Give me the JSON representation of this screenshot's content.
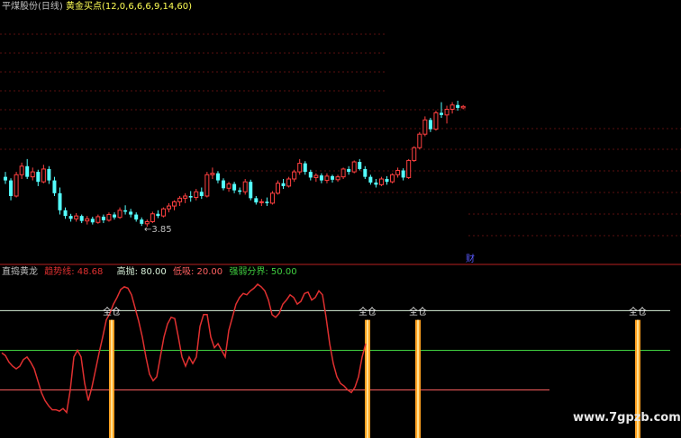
{
  "top_panel": {
    "title": "平煤股份(日线)",
    "indicator": "黄金买点(12,0,6,6,6,9,14,60)",
    "low_annotation": "←3.85",
    "event_marker": "财",
    "colors": {
      "up": "#ff4040",
      "down": "#54ffff",
      "text": "#c0c0c0",
      "indicator_text": "#ffff54"
    }
  },
  "bottom_panel": {
    "title": "直捣黄龙",
    "trend_label": "趋势线",
    "trend_value": "48.68",
    "high_label": "高抛",
    "high_value": "80.00",
    "low_label": "低吸",
    "low_value": "20.00",
    "mid_label": "强弱分界",
    "mid_value": "50.00",
    "signal_label": "全仓",
    "colors": {
      "trend": "#e03030",
      "high": "#d8f0d8",
      "low": "#ff6060",
      "mid": "#40d040",
      "signal": "#ffa020"
    }
  },
  "watermark": "www.7gpzb.com",
  "chart_data": [
    {
      "type": "candlestick",
      "title": "平煤股份(日线)",
      "series": [
        {
          "name": "",
          "values": [
            [
              4.55,
              4.62,
              4.45,
              4.5
            ],
            [
              4.5,
              4.53,
              4.22,
              4.28
            ],
            [
              4.28,
              4.62,
              4.26,
              4.58
            ],
            [
              4.58,
              4.75,
              4.52,
              4.7
            ],
            [
              4.7,
              4.8,
              4.52,
              4.55
            ],
            [
              4.55,
              4.68,
              4.5,
              4.62
            ],
            [
              4.62,
              4.65,
              4.42,
              4.48
            ],
            [
              4.48,
              4.72,
              4.46,
              4.66
            ],
            [
              4.66,
              4.7,
              4.45,
              4.5
            ],
            [
              4.5,
              4.55,
              4.28,
              4.32
            ],
            [
              4.32,
              4.4,
              4.02,
              4.08
            ],
            [
              4.08,
              4.12,
              3.96,
              4.0
            ],
            [
              4.0,
              4.03,
              3.92,
              3.96
            ],
            [
              3.96,
              4.04,
              3.92,
              4.0
            ],
            [
              4.0,
              4.02,
              3.9,
              3.93
            ],
            [
              3.93,
              4.0,
              3.88,
              3.96
            ],
            [
              3.96,
              3.99,
              3.88,
              3.91
            ],
            [
              3.91,
              4.02,
              3.89,
              3.99
            ],
            [
              3.99,
              4.02,
              3.9,
              3.94
            ],
            [
              3.94,
              4.05,
              3.92,
              4.02
            ],
            [
              4.02,
              4.05,
              3.95,
              3.98
            ],
            [
              3.98,
              4.12,
              3.96,
              4.08
            ],
            [
              4.08,
              4.15,
              4.02,
              4.06
            ],
            [
              4.06,
              4.1,
              3.98,
              4.02
            ],
            [
              4.02,
              4.05,
              3.92,
              3.95
            ],
            [
              3.95,
              3.98,
              3.86,
              3.89
            ],
            [
              3.89,
              3.95,
              3.85,
              3.92
            ],
            [
              3.92,
              4.06,
              3.9,
              4.03
            ],
            [
              4.03,
              4.08,
              3.97,
              4.0
            ],
            [
              4.0,
              4.12,
              3.98,
              4.1
            ],
            [
              4.1,
              4.18,
              4.05,
              4.14
            ],
            [
              4.14,
              4.22,
              4.08,
              4.2
            ],
            [
              4.2,
              4.28,
              4.14,
              4.25
            ],
            [
              4.25,
              4.32,
              4.18,
              4.28
            ],
            [
              4.28,
              4.35,
              4.2,
              4.26
            ],
            [
              4.26,
              4.38,
              4.22,
              4.34
            ],
            [
              4.34,
              4.4,
              4.24,
              4.28
            ],
            [
              4.28,
              4.62,
              4.26,
              4.58
            ],
            [
              4.58,
              4.68,
              4.52,
              4.6
            ],
            [
              4.6,
              4.63,
              4.46,
              4.5
            ],
            [
              4.5,
              4.53,
              4.36,
              4.39
            ],
            [
              4.39,
              4.48,
              4.34,
              4.45
            ],
            [
              4.45,
              4.48,
              4.32,
              4.36
            ],
            [
              4.36,
              4.4,
              4.3,
              4.34
            ],
            [
              4.34,
              4.52,
              4.3,
              4.48
            ],
            [
              4.48,
              4.51,
              4.22,
              4.25
            ],
            [
              4.25,
              4.28,
              4.16,
              4.19
            ],
            [
              4.19,
              4.24,
              4.14,
              4.2
            ],
            [
              4.2,
              4.26,
              4.14,
              4.18
            ],
            [
              4.18,
              4.35,
              4.16,
              4.32
            ],
            [
              4.32,
              4.5,
              4.3,
              4.46
            ],
            [
              4.46,
              4.52,
              4.38,
              4.42
            ],
            [
              4.42,
              4.55,
              4.4,
              4.52
            ],
            [
              4.52,
              4.65,
              4.48,
              4.62
            ],
            [
              4.62,
              4.8,
              4.58,
              4.74
            ],
            [
              4.74,
              4.77,
              4.58,
              4.62
            ],
            [
              4.62,
              4.65,
              4.5,
              4.54
            ],
            [
              4.54,
              4.6,
              4.48,
              4.57
            ],
            [
              4.57,
              4.6,
              4.46,
              4.5
            ],
            [
              4.5,
              4.6,
              4.46,
              4.56
            ],
            [
              4.56,
              4.58,
              4.47,
              4.51
            ],
            [
              4.51,
              4.58,
              4.48,
              4.55
            ],
            [
              4.55,
              4.68,
              4.52,
              4.66
            ],
            [
              4.66,
              4.7,
              4.58,
              4.62
            ],
            [
              4.62,
              4.78,
              4.6,
              4.76
            ],
            [
              4.76,
              4.8,
              4.64,
              4.66
            ],
            [
              4.66,
              4.7,
              4.52,
              4.55
            ],
            [
              4.55,
              4.58,
              4.44,
              4.47
            ],
            [
              4.47,
              4.52,
              4.4,
              4.44
            ],
            [
              4.44,
              4.55,
              4.42,
              4.52
            ],
            [
              4.52,
              4.56,
              4.44,
              4.48
            ],
            [
              4.48,
              4.6,
              4.46,
              4.58
            ],
            [
              4.58,
              4.68,
              4.54,
              4.64
            ],
            [
              4.64,
              4.67,
              4.5,
              4.54
            ],
            [
              4.54,
              4.8,
              4.52,
              4.78
            ],
            [
              4.78,
              4.98,
              4.76,
              4.96
            ],
            [
              4.96,
              5.18,
              4.94,
              5.15
            ],
            [
              5.15,
              5.4,
              5.12,
              5.35
            ],
            [
              5.35,
              5.38,
              5.18,
              5.22
            ],
            [
              5.22,
              5.48,
              5.2,
              5.45
            ],
            [
              5.45,
              5.6,
              5.38,
              5.42
            ],
            [
              5.42,
              5.55,
              5.3,
              5.5
            ],
            [
              5.5,
              5.6,
              5.44,
              5.56
            ],
            [
              5.56,
              5.62,
              5.48,
              5.52
            ],
            [
              5.52,
              5.56,
              5.5,
              5.54
            ]
          ]
        }
      ]
    },
    {
      "type": "line",
      "title": "直捣黄龙",
      "ylim": [
        0,
        100
      ],
      "series": [
        {
          "name": "趋势线",
          "values": [
            48,
            46,
            41,
            38,
            36,
            38,
            43,
            45,
            41,
            36,
            27,
            18,
            12,
            8,
            5,
            5,
            4,
            6,
            3,
            20,
            45,
            50,
            45,
            25,
            12,
            22,
            35,
            48,
            60,
            73,
            78,
            85,
            90,
            96,
            98,
            97,
            92,
            82,
            72,
            60,
            45,
            32,
            27,
            30,
            45,
            60,
            70,
            75,
            74,
            60,
            45,
            38,
            45,
            40,
            45,
            68,
            77,
            77,
            60,
            52,
            55,
            50,
            45,
            65,
            75,
            85,
            90,
            93,
            92,
            95,
            97,
            100,
            98,
            95,
            88,
            77,
            75,
            78,
            85,
            88,
            92,
            90,
            85,
            87,
            93,
            94,
            88,
            90,
            95,
            92,
            75,
            55,
            40,
            30,
            25,
            23,
            20,
            18,
            22,
            30,
            45,
            55
          ]
        },
        {
          "name": "高抛",
          "values": [
            80
          ]
        },
        {
          "name": "低吸",
          "values": [
            20
          ]
        },
        {
          "name": "强弱分界",
          "values": [
            50
          ]
        }
      ],
      "annotations": [
        "全仓",
        "全仓",
        "全仓",
        "全仓"
      ],
      "signal_x": [
        31,
        102,
        116,
        177
      ]
    }
  ]
}
